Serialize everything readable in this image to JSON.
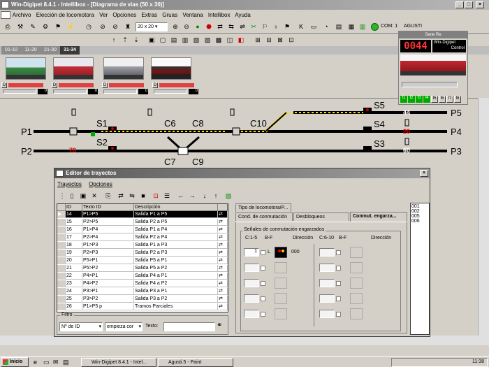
{
  "app": {
    "title": "Win-Digipet 8.4.1 - Intellibox - [Diagrama de vias (50 x 30)]"
  },
  "menu": [
    "Archivo",
    "Elección de locomotora",
    "Ver",
    "Opciones",
    "Extras",
    "Gruas",
    "Ventana",
    "Intellibox",
    "Ayuda"
  ],
  "toolbar": {
    "grid_size": "20 x 20",
    "com": "COM: 1",
    "user": "AGUSTI"
  },
  "loco_tabs": [
    "01-10",
    "11-20",
    "21-30",
    "31-34"
  ],
  "loco_speed": [
    "0",
    "0",
    "0",
    "0"
  ],
  "track": {
    "left_labels": [
      "P1",
      "P2"
    ],
    "right_labels": [
      "P5",
      "P4",
      "P3"
    ],
    "signals": [
      "S1",
      "S2",
      "S3",
      "S4",
      "S5"
    ],
    "switches": [
      "C6",
      "C8",
      "C7",
      "C9",
      "C10"
    ],
    "numbers": {
      "p2": "70",
      "s5": "44",
      "s4": "20",
      "s3": "60"
    }
  },
  "mini": {
    "display": "0044",
    "title": "Serie Re",
    "brand": "Win-Digipet",
    "control": "Control",
    "funcs": [
      "f1",
      "f2",
      "f3",
      "f4",
      "f5",
      "f6",
      "f7",
      "f8"
    ]
  },
  "editor": {
    "title": "Editor de trayectos",
    "menu": [
      "Trayectos",
      "Opciones"
    ],
    "columns": [
      "ID",
      "Texto ID",
      "Descripción"
    ],
    "rows": [
      {
        "id": "14",
        "text": "P1>P5",
        "desc": "Salida P1 a P5"
      },
      {
        "id": "15",
        "text": "P2>P5",
        "desc": "Salida P2 a P5"
      },
      {
        "id": "16",
        "text": "P1>P4",
        "desc": "Salida P1 a P4"
      },
      {
        "id": "17",
        "text": "P2>P4",
        "desc": "Salida P2 a P4"
      },
      {
        "id": "18",
        "text": "P1>P3",
        "desc": "Salida P1 a P3"
      },
      {
        "id": "19",
        "text": "P2>P3",
        "desc": "Salida P2 a P3"
      },
      {
        "id": "20",
        "text": "P5>P1",
        "desc": "Salida P5 a P1"
      },
      {
        "id": "21",
        "text": "P5>P2",
        "desc": "Salida P5 a P2"
      },
      {
        "id": "22",
        "text": "P4>P1",
        "desc": "Salida P4 a P1"
      },
      {
        "id": "23",
        "text": "P4>P2",
        "desc": "Salida P4 a P2"
      },
      {
        "id": "24",
        "text": "P3>P1",
        "desc": "Salida P3 a P1"
      },
      {
        "id": "25",
        "text": "P3>P2",
        "desc": "Salida P3 a P2"
      },
      {
        "id": "26",
        "text": "P1>P5 p",
        "desc": "Tramos Parciales"
      }
    ],
    "filter": {
      "legend": "Filtro",
      "field": "Nº de ID",
      "mode": "empieza cor",
      "text_label": "Texto:"
    },
    "tabs": {
      "top": "Tipo de locomotora/P...",
      "a": "Cond. de conmutación",
      "b": "Desbloqueos",
      "c": "Conmut. engarza..."
    },
    "group": "Señales de conmutación engarzados",
    "hdr": {
      "c15": "C:1-5",
      "bf": "B-F",
      "dir": "Dirección",
      "c610": "C:6-10",
      "bf2": "B-F",
      "dir2": "Dirección"
    },
    "first_val": "1",
    "first_L": "L",
    "first_dir": "000",
    "ids": [
      "001",
      "002",
      "005",
      "006"
    ]
  },
  "taskbar": {
    "start": "Inicio",
    "t1": "Win-Digipet 8.4.1 - Intel...",
    "t2": "Agusti.5 - Paint",
    "clock": "11:38"
  }
}
